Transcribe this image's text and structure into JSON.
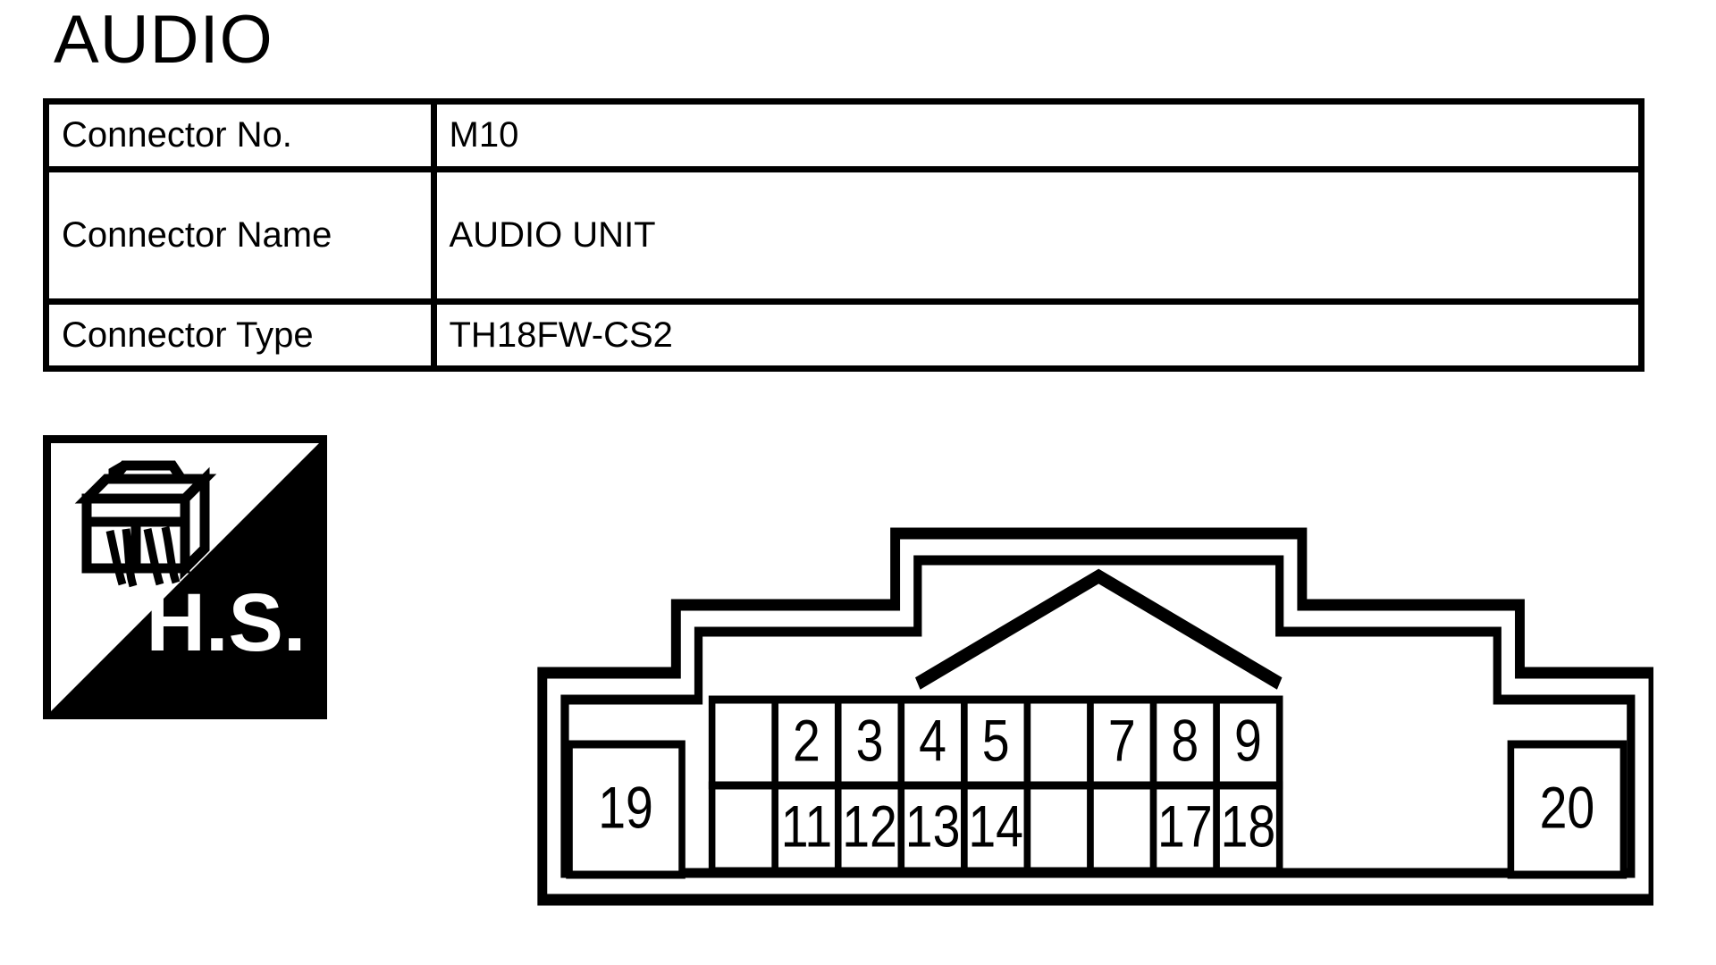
{
  "page": {
    "title": "AUDIO"
  },
  "info_table": {
    "rows": [
      {
        "label": "Connector No.",
        "value": "M10"
      },
      {
        "label": "Connector Name",
        "value": "AUDIO UNIT"
      },
      {
        "label": "Connector Type",
        "value": "TH18FW-CS2"
      }
    ]
  },
  "hs_badge": {
    "label": "H.S.",
    "icon": "connector-harness-icon",
    "background_dark": "#000000",
    "background_light": "#ffffff"
  },
  "connector": {
    "name": "connector-pinout-diagram",
    "total_positions": 20,
    "columns": 9,
    "rows": 2,
    "left_pin": "19",
    "right_pin": "20",
    "top_row": [
      "",
      "2",
      "3",
      "4",
      "5",
      "",
      "7",
      "8",
      "9"
    ],
    "bottom_row": [
      "",
      "11",
      "12",
      "13",
      "14",
      "",
      "",
      "17",
      "18"
    ],
    "line_color": "#000000",
    "fill_color": "#ffffff"
  }
}
